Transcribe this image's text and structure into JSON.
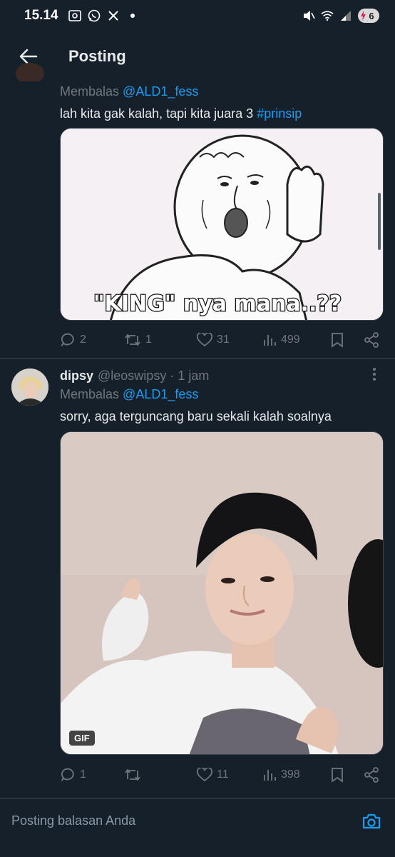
{
  "status_bar": {
    "time": "15.14",
    "battery": "6"
  },
  "header": {
    "title": "Posting"
  },
  "tweet1": {
    "reply_prefix": "Membalas",
    "reply_handle": "@ALD1_fess",
    "text": "lah kita gak kalah, tapi kita juara 3",
    "hashtag": "#prinsip",
    "image_caption": "\"KING\" nya mana..??",
    "stats": {
      "replies": "2",
      "retweets": "1",
      "likes": "31",
      "views": "499"
    }
  },
  "tweet2": {
    "name": "dipsy",
    "handle": "@leoswipsy",
    "time": "1 jam",
    "reply_prefix": "Membalas",
    "reply_handle": "@ALD1_fess",
    "text": "sorry, aga terguncang baru sekali kalah soalnya",
    "gif_label": "GIF",
    "stats": {
      "replies": "1",
      "retweets": "",
      "likes": "11",
      "views": "398"
    }
  },
  "composer": {
    "placeholder": "Posting balasan Anda"
  },
  "colors": {
    "background": "#15202b",
    "accent": "#1d9bf0",
    "muted": "#71767b"
  }
}
